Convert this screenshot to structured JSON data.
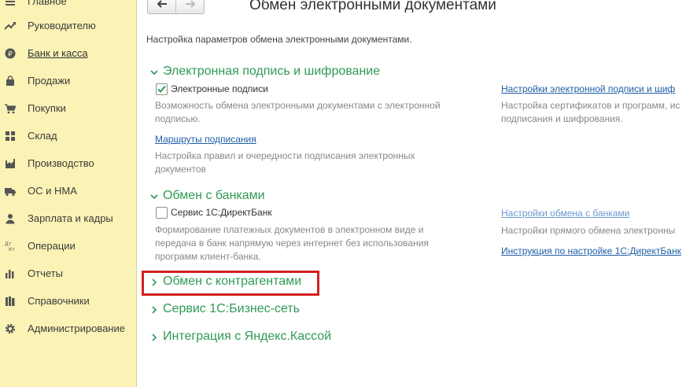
{
  "sidebar": {
    "items": [
      {
        "label": "Главное",
        "icon": "menu-icon"
      },
      {
        "label": "Руководителю",
        "icon": "trend-icon"
      },
      {
        "label": "Банк и касса",
        "icon": "ruble-icon"
      },
      {
        "label": "Продажи",
        "icon": "bag-icon"
      },
      {
        "label": "Покупки",
        "icon": "cart-icon"
      },
      {
        "label": "Склад",
        "icon": "grid-icon"
      },
      {
        "label": "Производство",
        "icon": "factory-icon"
      },
      {
        "label": "ОС и НМА",
        "icon": "truck-icon"
      },
      {
        "label": "Зарплата и кадры",
        "icon": "person-icon"
      },
      {
        "label": "Операции",
        "icon": "dt-kt-icon"
      },
      {
        "label": "Отчеты",
        "icon": "bar-chart-icon"
      },
      {
        "label": "Справочники",
        "icon": "books-icon"
      },
      {
        "label": "Администрирование",
        "icon": "gear-icon"
      }
    ]
  },
  "header": {
    "back_icon": "arrow-left-icon",
    "forward_icon": "arrow-right-icon",
    "title": "Обмен электронными документами"
  },
  "main": {
    "intro": "Настройка параметров обмена электронными документами.",
    "sections": {
      "signature": {
        "title": "Электронная подпись и шифрование",
        "checkbox_label": "Электронные подписи",
        "checkbox_checked": true,
        "checkbox_desc": "Возможность обмена электронными документами с электронной подписью.",
        "routes_link": "Маршруты подписания",
        "routes_desc": "Настройка правил и очередности подписания электронных документов",
        "settings_link": "Настройки электронной подписи и шиф",
        "settings_desc": "Настройка сертификатов и программ, ис подписания и шифрования."
      },
      "banks": {
        "title": "Обмен с банками",
        "checkbox_label": "Сервис 1С:ДиректБанк",
        "checkbox_checked": false,
        "checkbox_desc": "Формирование платежных документов в электронном виде и передача в банк напрямую через интернет без использования программ клиент-банка.",
        "exchange_link": "Настройки обмена с банками",
        "exchange_desc": "Настройки прямого обмена электронны",
        "manual_link": "Инструкция по настройке 1С:ДиректБанк"
      },
      "contractors": {
        "title": "Обмен с контрагентами"
      },
      "business_network": {
        "title": "Сервис 1С:Бизнес-сеть"
      },
      "yandex": {
        "title": "Интеграция с Яндекс.Кассой"
      }
    }
  },
  "colors": {
    "sidebar_bg": "#fbf3b6",
    "section_title": "#2f9a55",
    "link": "#1f5ea6",
    "highlight": "#d42020"
  }
}
